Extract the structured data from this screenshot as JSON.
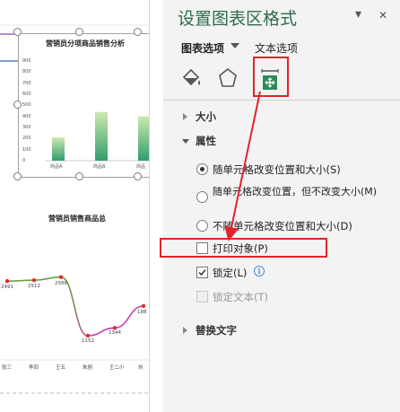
{
  "sheet": {
    "chart1": {
      "title": "营销员分项商品销售分析",
      "y_ticks": [
        "900",
        "800",
        "700",
        "600",
        "500",
        "400",
        "300",
        "200",
        "100",
        "0"
      ],
      "x_labels": [
        "商品A",
        "商品B",
        "商品"
      ]
    },
    "chart2": {
      "title": "营销员销售商品总",
      "point_labels": [
        "2491",
        "2512",
        "2588",
        "1152",
        "1344",
        "188"
      ],
      "name_labels": [
        "张三",
        "李四",
        "王五",
        "朱旭",
        "王二小",
        "刘"
      ]
    }
  },
  "chart_data": [
    {
      "type": "bar",
      "title": "营销员分项商品销售分析",
      "categories": [
        "商品A",
        "商品B",
        "商品"
      ],
      "values": [
        210,
        440,
        400
      ],
      "ylim": [
        0,
        900
      ],
      "colors": [
        "#2f9f6c",
        "#cfe8b0"
      ]
    },
    {
      "type": "line",
      "title": "营销员销售商品总",
      "categories": [
        "张三",
        "李四",
        "王五",
        "朱旭",
        "王二小",
        "刘"
      ],
      "values": [
        2491,
        2512,
        2588,
        1152,
        1344,
        1880
      ],
      "colors": [
        "#6a9f3f",
        "#c83fae"
      ]
    }
  ],
  "pane": {
    "title": "设置图表区格式",
    "chevron": "▾",
    "close": "✕",
    "tabs": {
      "chart_options": "图表选项",
      "text_options": "文本选项"
    },
    "icons": [
      "fill-line-icon",
      "effects-icon",
      "size-properties-icon"
    ],
    "sections": {
      "size": "大小",
      "properties": "属性",
      "alt_text": "替换文字"
    },
    "properties": {
      "radio1": "随单元格改变位置和大小(S)",
      "radio2": "随单元格改变位置，但不改变大小(M)",
      "radio3": "不随单元格改变位置和大小(D)",
      "print_object": "打印对象(P)",
      "locked": "锁定(L)",
      "lock_text": "锁定文本(T)",
      "info": "i"
    },
    "accent": "#2e6b4a",
    "highlight": "#e0242a"
  }
}
